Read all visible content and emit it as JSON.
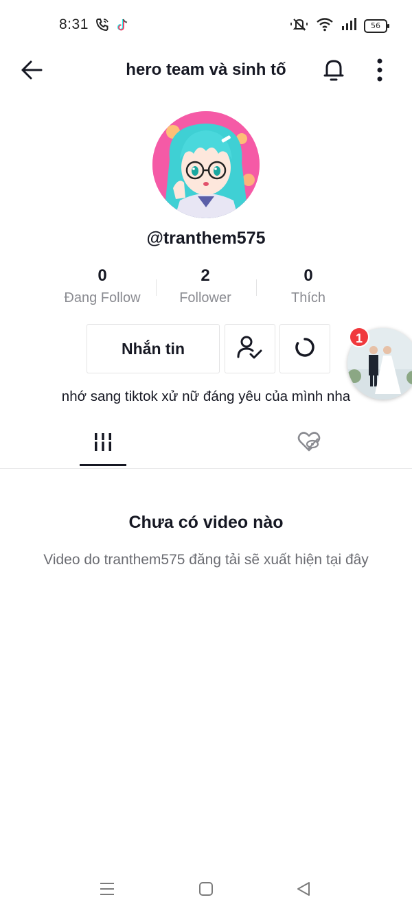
{
  "status_bar": {
    "time": "8:31",
    "battery": "56",
    "icons": [
      "phone-wifi-call-icon",
      "tiktok-notification-icon",
      "mute-icon",
      "wifi-icon",
      "signal-icon",
      "battery-icon"
    ]
  },
  "nav": {
    "title": "hero team và sinh tố",
    "back_icon": "arrow-left-icon",
    "bell_icon": "bell-icon",
    "more_icon": "more-vertical-icon"
  },
  "profile": {
    "username": "@tranthem575",
    "bio": "nhớ sang tiktok xử nữ đáng yêu của mình nha"
  },
  "stats": [
    {
      "value": "0",
      "label": "Đang Follow"
    },
    {
      "value": "2",
      "label": "Follower"
    },
    {
      "value": "0",
      "label": "Thích"
    }
  ],
  "actions": {
    "message_label": "Nhắn tin",
    "following_icon": "user-check-icon",
    "suggest_icon": "refresh-circle-icon"
  },
  "floating": {
    "badge": "1"
  },
  "tabs": [
    {
      "name": "videos",
      "icon": "grid-bars-icon",
      "active": true
    },
    {
      "name": "liked",
      "icon": "heart-hidden-icon",
      "active": false
    }
  ],
  "empty_state": {
    "title": "Chưa có video nào",
    "description": "Video do tranthem575 đăng tải sẽ xuất hiện tại đây"
  },
  "system_nav": [
    "menu-icon",
    "home-square-icon",
    "back-triangle-icon"
  ],
  "colors": {
    "text": "#161823",
    "muted": "#8a8b91",
    "border": "#e3e3e4",
    "badge": "#f0393d",
    "avatar_bg": "#f55aa6"
  }
}
